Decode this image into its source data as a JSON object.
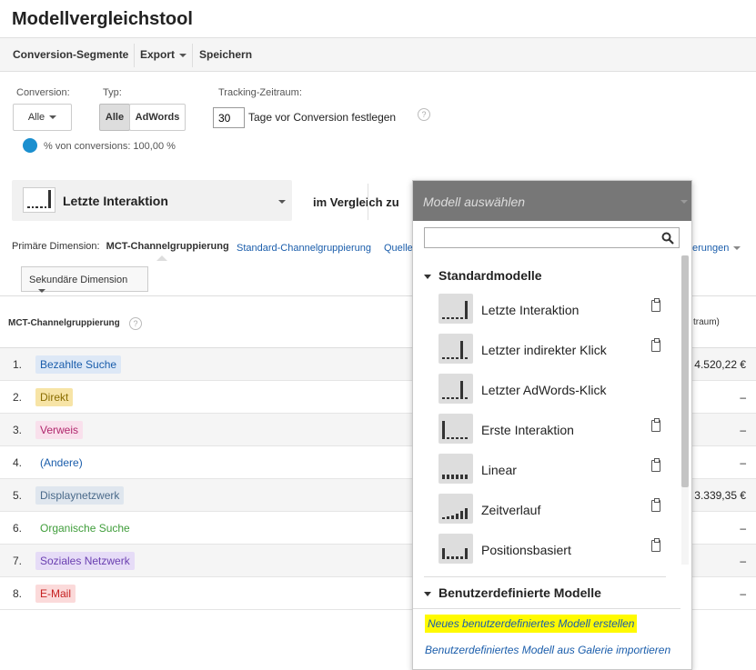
{
  "title": "Modellvergleichstool",
  "toolbar": {
    "conversion_segments": "Conversion-Segmente",
    "export": "Export",
    "save": "Speichern"
  },
  "filters": {
    "conversion_label": "Conversion:",
    "conversion_value": "Alle",
    "type_label": "Typ:",
    "type_all": "Alle",
    "type_adwords": "AdWords",
    "tracking_label": "Tracking-Zeitraum:",
    "tracking_days": "30",
    "tracking_suffix": "Tage vor Conversion festlegen",
    "pct_text": "% von conversions: 100,00 %"
  },
  "model_selector": {
    "current": "Letzte Interaktion",
    "compare_label": "im Vergleich zu"
  },
  "dimensions": {
    "primary_label": "Primäre Dimension:",
    "active": "MCT-Channelgruppierung",
    "link1": "Standard-Channelgruppierung",
    "link2": "Quelle",
    "link3": "erungen",
    "secondary_button": "Sekundäre Dimension"
  },
  "table": {
    "header": "MCT-Channelgruppierung",
    "header_right": "traum)",
    "rows": [
      {
        "num": "1.",
        "label": "Bezahlte Suche",
        "value": "4.520,22 €",
        "color": "#1a5dab",
        "bg": "#dde8f6"
      },
      {
        "num": "2.",
        "label": "Direkt",
        "value": "–",
        "color": "#8a6d00",
        "bg": "#f7e4a6"
      },
      {
        "num": "3.",
        "label": "Verweis",
        "value": "–",
        "color": "#b0276d",
        "bg": "#f9e0ec"
      },
      {
        "num": "4.",
        "label": "(Andere)",
        "value": "–",
        "color": "#1a5dab",
        "bg": "transparent"
      },
      {
        "num": "5.",
        "label": "Displaynetzwerk",
        "value": "3.339,35 €",
        "color": "#4a6a8a",
        "bg": "#dfe6ee"
      },
      {
        "num": "6.",
        "label": "Organische Suche",
        "value": "–",
        "color": "#3f9d3a",
        "bg": "#ffffff"
      },
      {
        "num": "7.",
        "label": "Soziales Netzwerk",
        "value": "–",
        "color": "#6a3fb0",
        "bg": "#e6dcf7"
      },
      {
        "num": "8.",
        "label": "E-Mail",
        "value": "–",
        "color": "#c62020",
        "bg": "#fbdada"
      }
    ]
  },
  "dropdown": {
    "placeholder": "Modell auswählen",
    "section_standard": "Standardmodelle",
    "models": [
      {
        "label": "Letzte Interaktion",
        "copy": true
      },
      {
        "label": "Letzter indirekter Klick",
        "copy": true
      },
      {
        "label": "Letzter AdWords-Klick",
        "copy": false
      },
      {
        "label": "Erste Interaktion",
        "copy": true
      },
      {
        "label": "Linear",
        "copy": true
      },
      {
        "label": "Zeitverlauf",
        "copy": true
      },
      {
        "label": "Positionsbasiert",
        "copy": true
      }
    ],
    "section_custom": "Benutzerdefinierte Modelle",
    "create_link": "Neues benutzerdefiniertes Modell erstellen",
    "import_link": "Benutzerdefiniertes Modell aus Galerie importieren"
  }
}
